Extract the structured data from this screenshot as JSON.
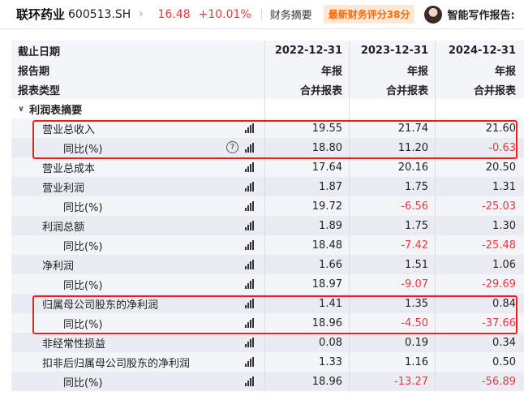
{
  "header": {
    "stock_name": "联环药业",
    "stock_code": "600513.SH",
    "chevron": "›",
    "price": "16.48",
    "change": "+10.01%",
    "fin_summary": "财务摘要",
    "score_badge": "最新财务评分38分",
    "ai_report": "智能写作报告:"
  },
  "table": {
    "head_rows": [
      {
        "label": "截止日期",
        "values": [
          "2022-12-31",
          "2023-12-31",
          "2024-12-31"
        ]
      },
      {
        "label": "报告期",
        "values": [
          "年报",
          "年报",
          "年报"
        ]
      },
      {
        "label": "报表类型",
        "values": [
          "合并报表",
          "合并报表",
          "合并报表"
        ]
      }
    ],
    "section_label": "利润表摘要",
    "rows": [
      {
        "label": "营业总收入",
        "values": [
          "19.55",
          "21.74",
          "21.60"
        ]
      },
      {
        "label": "同比(%)",
        "values": [
          "18.80",
          "11.20",
          "-0.63"
        ],
        "help": "?"
      },
      {
        "label": "营业总成本",
        "values": [
          "17.64",
          "20.16",
          "20.50"
        ]
      },
      {
        "label": "营业利润",
        "values": [
          "1.87",
          "1.75",
          "1.31"
        ]
      },
      {
        "label": "同比(%)",
        "values": [
          "19.72",
          "-6.56",
          "-25.03"
        ]
      },
      {
        "label": "利润总额",
        "values": [
          "1.89",
          "1.75",
          "1.30"
        ]
      },
      {
        "label": "同比(%)",
        "values": [
          "18.48",
          "-7.42",
          "-25.48"
        ]
      },
      {
        "label": "净利润",
        "values": [
          "1.66",
          "1.51",
          "1.06"
        ]
      },
      {
        "label": "同比(%)",
        "values": [
          "18.97",
          "-9.07",
          "-29.69"
        ]
      },
      {
        "label": "归属母公司股东的净利润",
        "values": [
          "1.41",
          "1.35",
          "0.84"
        ]
      },
      {
        "label": "同比(%)",
        "values": [
          "18.96",
          "-4.50",
          "-37.66"
        ]
      },
      {
        "label": "非经常性损益",
        "values": [
          "0.08",
          "0.19",
          "0.34"
        ]
      },
      {
        "label": "扣非后归属母公司股东的净利润",
        "values": [
          "1.33",
          "1.16",
          "0.50"
        ]
      },
      {
        "label": "同比(%)",
        "values": [
          "18.96",
          "-13.27",
          "-56.89"
        ]
      }
    ]
  },
  "colors": {
    "negative": "#e4393c",
    "highlight_box": "#e8211e",
    "badge_text": "#ff6a00"
  }
}
